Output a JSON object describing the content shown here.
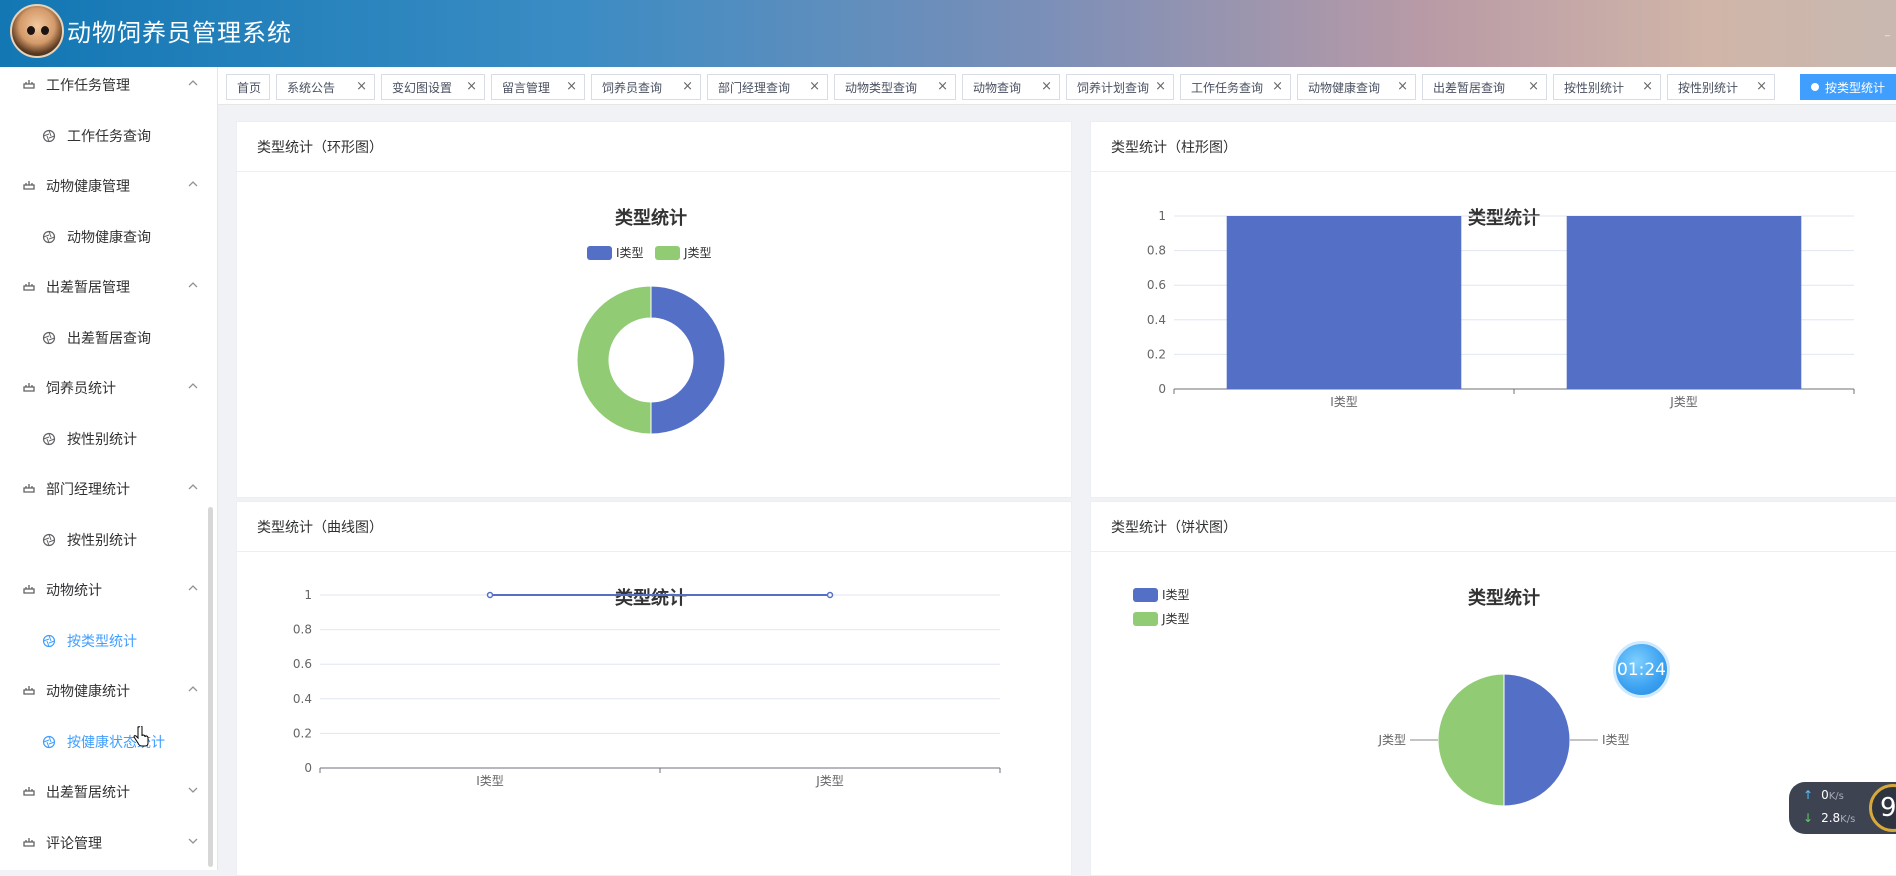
{
  "app": {
    "title": "动物饲养员管理系统"
  },
  "sidebar": {
    "items": [
      {
        "type": "menu",
        "label": "工作任务管理",
        "expanded": true
      },
      {
        "type": "sub",
        "label": "工作任务查询"
      },
      {
        "type": "menu",
        "label": "动物健康管理",
        "expanded": true
      },
      {
        "type": "sub",
        "label": "动物健康查询"
      },
      {
        "type": "menu",
        "label": "出差暂居管理",
        "expanded": true
      },
      {
        "type": "sub",
        "label": "出差暂居查询"
      },
      {
        "type": "menu",
        "label": "饲养员统计",
        "expanded": true
      },
      {
        "type": "sub",
        "label": "按性别统计"
      },
      {
        "type": "menu",
        "label": "部门经理统计",
        "expanded": true
      },
      {
        "type": "sub",
        "label": "按性别统计"
      },
      {
        "type": "menu",
        "label": "动物统计",
        "expanded": true
      },
      {
        "type": "sub",
        "label": "按类型统计",
        "active": true
      },
      {
        "type": "menu",
        "label": "动物健康统计",
        "expanded": true
      },
      {
        "type": "sub",
        "label": "按健康状态统计",
        "active": true
      },
      {
        "type": "menu",
        "label": "出差暂居统计",
        "expanded": false
      },
      {
        "type": "menu",
        "label": "评论管理",
        "expanded": false
      }
    ]
  },
  "tabs": [
    {
      "label": "首页",
      "closable": false
    },
    {
      "label": "系统公告",
      "closable": true
    },
    {
      "label": "变幻图设置",
      "closable": true
    },
    {
      "label": "留言管理",
      "closable": true
    },
    {
      "label": "饲养员查询",
      "closable": true
    },
    {
      "label": "部门经理查询",
      "closable": true
    },
    {
      "label": "动物类型查询",
      "closable": true
    },
    {
      "label": "动物查询",
      "closable": true
    },
    {
      "label": "饲养计划查询",
      "closable": true
    },
    {
      "label": "工作任务查询",
      "closable": true
    },
    {
      "label": "动物健康查询",
      "closable": true
    },
    {
      "label": "出差暂居查询",
      "closable": true
    },
    {
      "label": "按性别统计",
      "closable": true
    },
    {
      "label": "按性别统计",
      "closable": true
    },
    {
      "label": "按类型统计",
      "closable": false,
      "active": true
    }
  ],
  "tab_close_glyph": "×",
  "cards": {
    "ring": {
      "header": "类型统计（环形图）"
    },
    "bar": {
      "header": "类型统计（柱形图）"
    },
    "line": {
      "header": "类型统计（曲线图）"
    },
    "pie": {
      "header": "类型统计（饼状图）"
    }
  },
  "colors": {
    "accent": "#409eff",
    "series_i": "#5470c6",
    "series_j": "#91cc75"
  },
  "chart_data": [
    {
      "type": "pie",
      "variant": "ring",
      "title": "类型统计",
      "legend": "top",
      "categories": [
        "I类型",
        "J类型"
      ],
      "values": [
        1,
        1
      ]
    },
    {
      "type": "bar",
      "title": "类型统计",
      "categories": [
        "I类型",
        "J类型"
      ],
      "values": [
        1,
        1
      ],
      "ylim": [
        0,
        1
      ],
      "yticks": [
        "0",
        "0.2",
        "0.4",
        "0.6",
        "0.8",
        "1"
      ],
      "grid": true
    },
    {
      "type": "line",
      "title": "类型统计",
      "categories": [
        "I类型",
        "J类型"
      ],
      "values": [
        1,
        1
      ],
      "ylim": [
        0,
        1
      ],
      "yticks": [
        "0",
        "0.2",
        "0.4",
        "0.6",
        "0.8",
        "1"
      ],
      "grid": true
    },
    {
      "type": "pie",
      "title": "类型统计",
      "legend": "top-left",
      "categories": [
        "I类型",
        "J类型"
      ],
      "values": [
        1,
        1
      ]
    }
  ],
  "overlays": {
    "timer": "01:24",
    "network": {
      "up": "0",
      "up_unit": "K/s",
      "down": "2.8",
      "down_unit": "K/s",
      "badge": "9"
    }
  }
}
